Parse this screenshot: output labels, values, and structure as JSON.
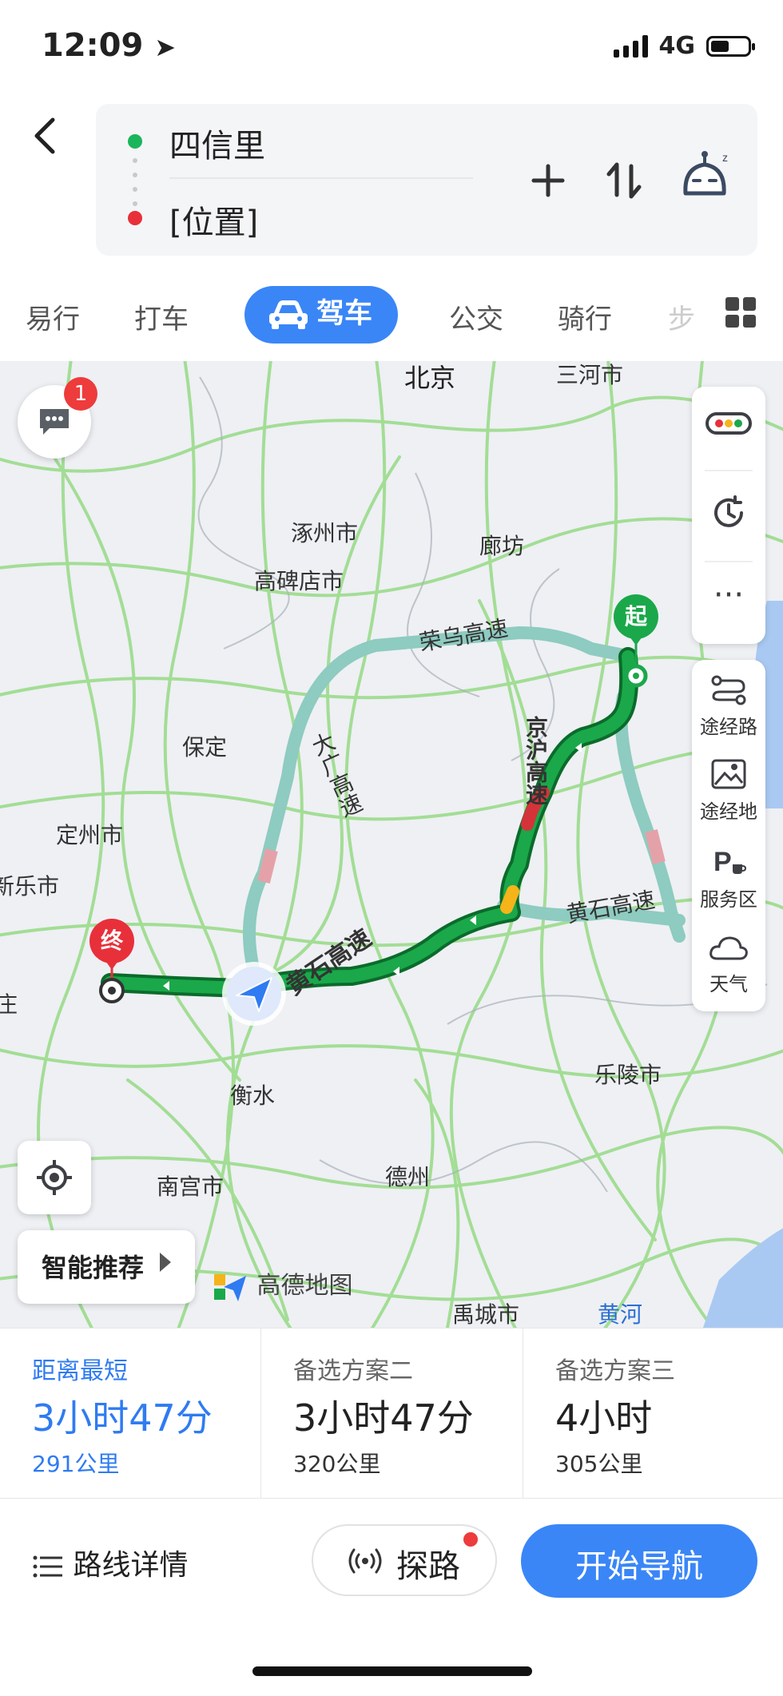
{
  "status_bar": {
    "time": "12:09",
    "network": "4G"
  },
  "route": {
    "origin": "四信里",
    "destination": "[位置]"
  },
  "tabs": [
    {
      "label": "易行"
    },
    {
      "label": "打车"
    },
    {
      "label": "驾车",
      "active": true
    },
    {
      "label": "公交"
    },
    {
      "label": "骑行"
    },
    {
      "label": "步"
    }
  ],
  "map": {
    "cities": {
      "beijing": "北京",
      "sanhe": "三河市",
      "zhuozhou": "涿州市",
      "langfang": "廊坊",
      "gaobeidian": "高碑店市",
      "baoding": "保定",
      "dingzhou": "定州市",
      "xinle": "新乐市",
      "zhuang": "庄",
      "hengshui": "衡水",
      "laoling": "乐陵市",
      "dezhou": "德州",
      "nangong": "南宫市",
      "yucheng": "禹城市",
      "huanghe": "黄河"
    },
    "roads": {
      "rongwu": "荣乌高速",
      "daguang": "大广高速",
      "jinghu": "京沪高速",
      "huangshi_east": "黄石高速",
      "huangshi_main": "黄石高速"
    },
    "markers": {
      "start": "起",
      "end": "终"
    },
    "message_badge": "1",
    "side_tools": {
      "traffic": "traffic-icon",
      "history": "history-icon",
      "more": "more-icon",
      "waypoint_road": "途经路",
      "waypoint_place": "途经地",
      "service_area": "服务区",
      "weather": "天气"
    },
    "smart_recommend": "智能推荐",
    "logo": "高德地图",
    "colors": {
      "route_main": "#1aa84a",
      "route_alt": "#8ecbc0",
      "road_green": "#76d36a",
      "jam_red": "#d5333a"
    }
  },
  "plans": [
    {
      "label": "距离最短",
      "time": "3小时47分",
      "distance": "291公里",
      "selected": true
    },
    {
      "label": "备选方案二",
      "time": "3小时47分",
      "distance": "320公里"
    },
    {
      "label": "备选方案三",
      "time": "4小时",
      "distance": "305公里"
    }
  ],
  "actions": {
    "detail": "路线详情",
    "probe": "探路",
    "start": "开始导航"
  }
}
